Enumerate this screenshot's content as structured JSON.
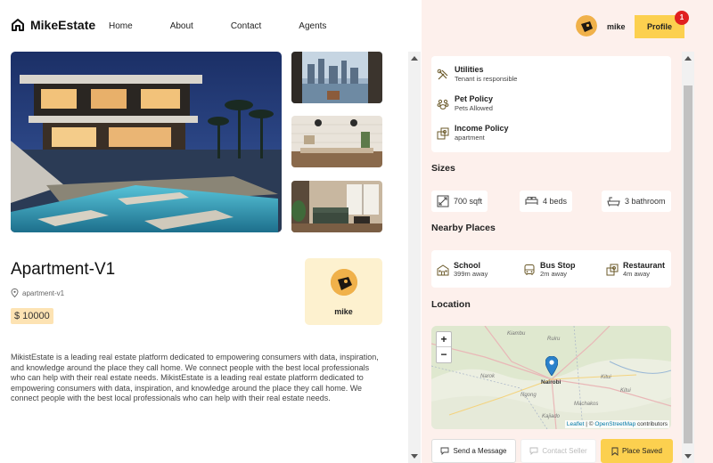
{
  "brand": {
    "name": "MikeEstate"
  },
  "nav": {
    "items": [
      "Home",
      "About",
      "Contact",
      "Agents"
    ]
  },
  "listing": {
    "title": "Apartment-V1",
    "address": "apartment-v1",
    "price": "$ 10000",
    "description": "MikistEstate is a leading real estate platform dedicated to empowering consumers with data, inspiration, and knowledge around the place they call home. We connect people with the best local professionals who can help with their real estate needs. MikistEstate is a leading real estate platform dedicated to empowering consumers with data, inspiration, and knowledge around the place they call home. We connect people with the best local professionals who can help with their real estate needs.",
    "agent": {
      "name": "mike"
    }
  },
  "user": {
    "name": "mike",
    "profile_label": "Profile",
    "notifications": "1"
  },
  "policies": [
    {
      "title": "Utilities",
      "subtitle": "Tenant is responsible",
      "icon": "tools-icon"
    },
    {
      "title": "Pet Policy",
      "subtitle": "Pets Allowed",
      "icon": "paw-icon"
    },
    {
      "title": "Income Policy",
      "subtitle": "apartment",
      "icon": "money-icon"
    }
  ],
  "sizes": {
    "title": "Sizes",
    "items": [
      {
        "label": "700 sqft",
        "icon": "area-icon"
      },
      {
        "label": "4 beds",
        "icon": "bed-icon"
      },
      {
        "label": "3 bathroom",
        "icon": "bath-icon"
      }
    ]
  },
  "nearby": {
    "title": "Nearby Places",
    "items": [
      {
        "title": "School",
        "subtitle": "399m away",
        "icon": "school-icon"
      },
      {
        "title": "Bus Stop",
        "subtitle": "2m away",
        "icon": "bus-icon"
      },
      {
        "title": "Restaurant",
        "subtitle": "4m away",
        "icon": "restaurant-icon"
      }
    ]
  },
  "location": {
    "title": "Location",
    "marker_label": "Nairobi",
    "zoom_in": "+",
    "zoom_out": "−",
    "attribution_leaflet": "Leaflet",
    "attribution_sep": " | © ",
    "attribution_osm": "OpenStreetMap",
    "attribution_tail": " contributors",
    "places": [
      "Kiambu",
      "Ruiru",
      "Ngong",
      "Narok",
      "Kitui",
      "Kitui",
      "Kajiado",
      "Machakos"
    ]
  },
  "actions": {
    "message": "Send a Message",
    "contact": "Contact Seller",
    "saved": "Place Saved"
  },
  "colors": {
    "accent": "#fcd04f",
    "panel_bg": "#fdf0ec",
    "price_bg": "#fde3b3",
    "agent_bg": "#fdf1cf",
    "badge": "#e02020"
  }
}
